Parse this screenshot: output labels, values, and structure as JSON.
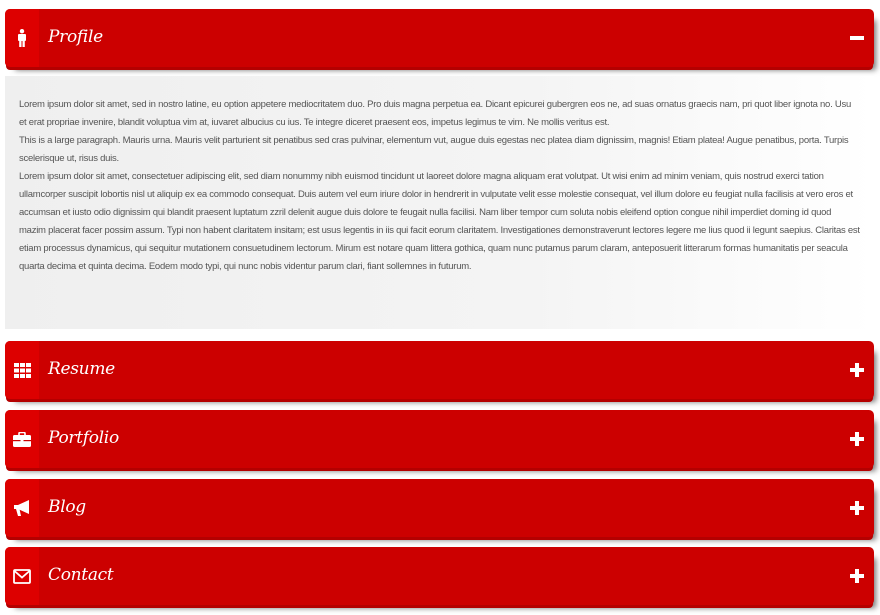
{
  "accordion": {
    "profile": {
      "title": "Profile",
      "icon": "person-icon",
      "expanded": true,
      "paragraphs": [
        "Lorem ipsum dolor sit amet, sed in nostro latine, eu option appetere mediocritatem duo. Pro duis magna perpetua ea. Dicant epicurei gubergren eos ne, ad suas ornatus graecis nam, pri quot liber ignota no. Usu et erat propriae invenire, blandit voluptua vim at, iuvaret albucius cu ius. Te integre diceret praesent eos, impetus legimus te vim. Ne mollis veritus est.",
        "This is a large paragraph. Mauris urna. Mauris velit parturient sit penatibus sed cras pulvinar, elementum vut, augue duis egestas nec platea diam dignissim, magnis! Etiam platea! Augue penatibus, porta. Turpis scelerisque ut, risus duis.",
        "Lorem ipsum dolor sit amet, consectetuer adipiscing elit, sed diam nonummy nibh euismod tincidunt ut laoreet dolore magna aliquam erat volutpat. Ut wisi enim ad minim veniam, quis nostrud exerci tation ullamcorper suscipit lobortis nisl ut aliquip ex ea commodo consequat. Duis autem vel eum iriure dolor in hendrerit in vulputate velit esse molestie consequat, vel illum dolore eu feugiat nulla facilisis at vero eros et accumsan et iusto odio dignissim qui blandit praesent luptatum zzril delenit augue duis dolore te feugait nulla facilisi. Nam liber tempor cum soluta nobis eleifend option congue nihil imperdiet doming id quod mazim placerat facer possim assum. Typi non habent claritatem insitam; est usus legentis in iis qui facit eorum claritatem. Investigationes demonstraverunt lectores legere me lius quod ii legunt saepius. Claritas est etiam processus dynamicus, qui sequitur mutationem consuetudinem lectorum. Mirum est notare quam littera gothica, quam nunc putamus parum claram, anteposuerit litterarum formas humanitatis per seacula quarta decima et quinta decima. Eodem modo typi, qui nunc nobis videntur parum clari, fiant sollemnes in futurum."
      ]
    },
    "resume": {
      "title": "Resume",
      "icon": "grid-icon",
      "expanded": false
    },
    "portfolio": {
      "title": "Portfolio",
      "icon": "briefcase-icon",
      "expanded": false
    },
    "blog": {
      "title": "Blog",
      "icon": "megaphone-icon",
      "expanded": false
    },
    "contact": {
      "title": "Contact",
      "icon": "envelope-icon",
      "expanded": false
    }
  },
  "colors": {
    "header": "#cc0000",
    "tab": "#dd0000",
    "content_bg": "#efefef",
    "text": "#555555"
  }
}
